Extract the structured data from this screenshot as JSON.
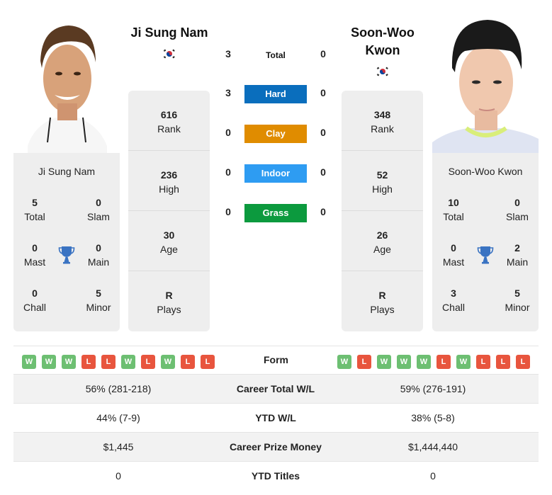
{
  "players": [
    {
      "name": "Ji Sung Nam",
      "name_lines": [
        "Ji Sung Nam"
      ],
      "country_flag": "south-korea-flag",
      "photo": "player-photo-ji-sung-nam",
      "rank": "616",
      "rank_label": "Rank",
      "high": "236",
      "high_label": "High",
      "age": "30",
      "age_label": "Age",
      "plays": "R",
      "plays_label": "Plays",
      "titles": {
        "total": "5",
        "slam": "0",
        "mast": "0",
        "main": "0",
        "chall": "0",
        "minor": "5"
      },
      "form": [
        "W",
        "W",
        "W",
        "L",
        "L",
        "W",
        "L",
        "W",
        "L",
        "L"
      ]
    },
    {
      "name": "Soon-Woo Kwon",
      "name_lines": [
        "Soon-Woo",
        "Kwon"
      ],
      "country_flag": "south-korea-flag",
      "photo": "player-photo-soon-woo-kwon",
      "rank": "348",
      "rank_label": "Rank",
      "high": "52",
      "high_label": "High",
      "age": "26",
      "age_label": "Age",
      "plays": "R",
      "plays_label": "Plays",
      "titles": {
        "total": "10",
        "slam": "0",
        "mast": "0",
        "main": "2",
        "chall": "3",
        "minor": "5"
      },
      "form": [
        "W",
        "L",
        "W",
        "W",
        "W",
        "L",
        "W",
        "L",
        "L",
        "L"
      ]
    }
  ],
  "title_labels": {
    "total": "Total",
    "slam": "Slam",
    "mast": "Mast",
    "main": "Main",
    "chall": "Chall",
    "minor": "Minor"
  },
  "h2h": [
    {
      "label": "Total",
      "p1": "3",
      "p2": "0",
      "color": null
    },
    {
      "label": "Hard",
      "p1": "3",
      "p2": "0",
      "color": "#0a6ebd"
    },
    {
      "label": "Clay",
      "p1": "0",
      "p2": "0",
      "color": "#e08c00"
    },
    {
      "label": "Indoor",
      "p1": "0",
      "p2": "0",
      "color": "#2e9cf2"
    },
    {
      "label": "Grass",
      "p1": "0",
      "p2": "0",
      "color": "#0c9a3e"
    }
  ],
  "form_label": "Form",
  "comparison": [
    {
      "label": "Career Total W/L",
      "p1": "56% (281-218)",
      "p2": "59% (276-191)"
    },
    {
      "label": "YTD W/L",
      "p1": "44% (7-9)",
      "p2": "38% (5-8)"
    },
    {
      "label": "Career Prize Money",
      "p1": "$1,445",
      "p2": "$1,444,440"
    },
    {
      "label": "YTD Titles",
      "p1": "0",
      "p2": "0"
    }
  ],
  "colors": {
    "win": "#6dbf72",
    "loss": "#e8553e",
    "trophy": "#3a73c2",
    "card_bg": "#eeeeee"
  }
}
